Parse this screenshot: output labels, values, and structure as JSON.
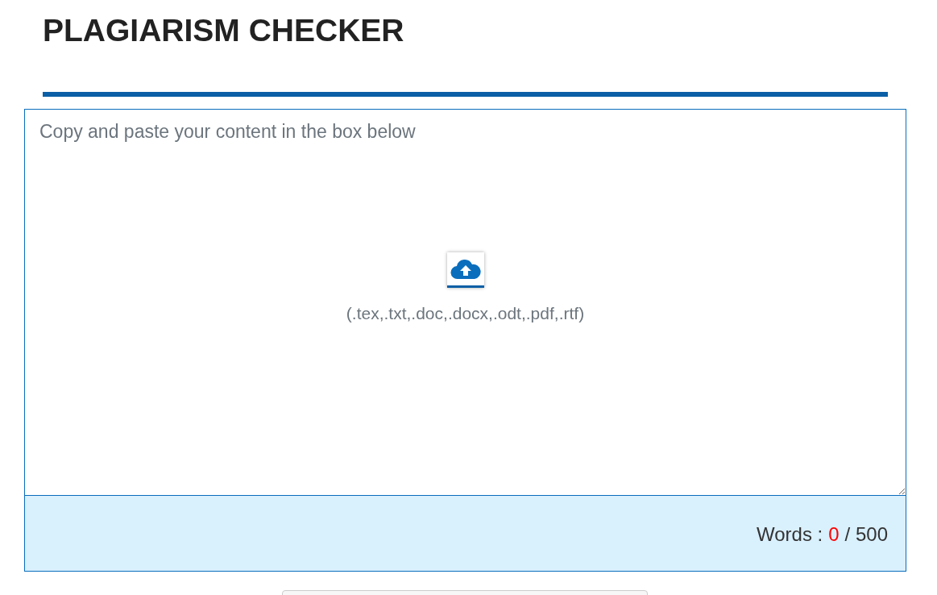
{
  "title": "PLAGIARISM CHECKER",
  "editor": {
    "placeholder": "Copy and paste your content in the box below",
    "formats": "(.tex,.txt,.doc,.docx,.odt,.pdf,.rtf)"
  },
  "word_count": {
    "label": "Words :",
    "count": "0",
    "limit": "/ 500"
  }
}
